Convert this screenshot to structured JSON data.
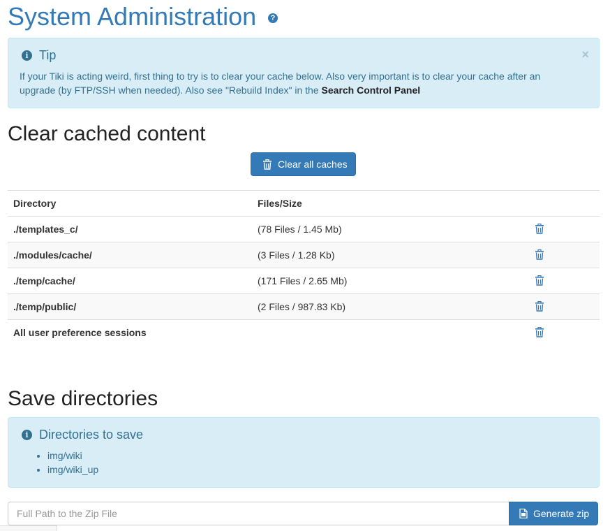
{
  "page": {
    "title": "System Administration",
    "help_glyph": "?"
  },
  "tip": {
    "icon": "info-icon",
    "icon_glyph": "i",
    "title": "Tip",
    "close_glyph": "×",
    "text": "If your Tiki is acting weird, first thing to try is to clear your cache below. Also very important is to clear your cache after an upgrade (by FTP/SSH when needed). Also see \"Rebuild Index\" in the ",
    "link_text": "Search Control Panel"
  },
  "clear_section": {
    "heading": "Clear cached content",
    "clear_all_label": "Clear all caches",
    "columns": [
      "Directory",
      "Files/Size"
    ],
    "rows": [
      {
        "directory": "./templates_c/",
        "size": "(78 Files / 1.45 Mb)"
      },
      {
        "directory": "./modules/cache/",
        "size": "(3 Files / 1.28 Kb)"
      },
      {
        "directory": "./temp/cache/",
        "size": "(171 Files / 2.65 Mb)"
      },
      {
        "directory": "./temp/public/",
        "size": "(2 Files / 987.83 Kb)"
      },
      {
        "directory": "All user preference sessions",
        "size": ""
      }
    ]
  },
  "save_section": {
    "heading": "Save directories",
    "box_title": "Directories to save",
    "icon_glyph": "i",
    "directories": [
      "img/wiki",
      "img/wiki_up"
    ],
    "zip_placeholder": "Full Path to the Zip File",
    "generate_label": "Generate zip"
  },
  "colors": {
    "primary": "#337ab7",
    "info_bg": "#d9edf7",
    "info_text": "#31708f"
  }
}
